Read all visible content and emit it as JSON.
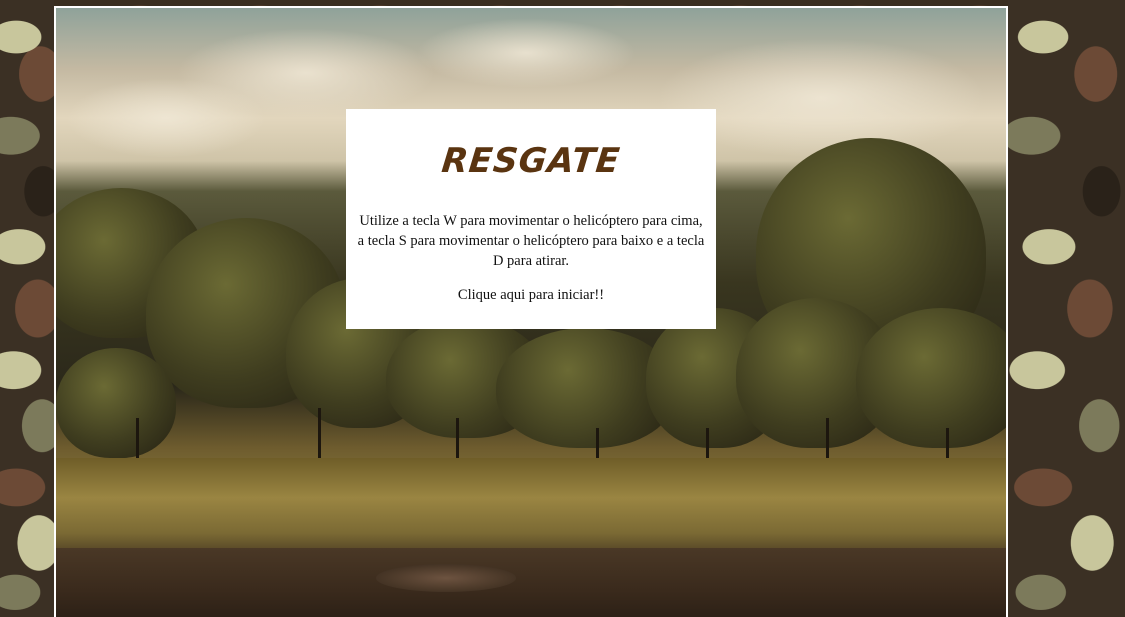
{
  "game": {
    "title": "RESGATE",
    "instructions": "Utilize a tecla W para movimentar o helicóptero para cima, a tecla S para movimentar o helicóptero para baixo e a tecla D para atirar.",
    "start_label": "Clique aqui para iniciar!!"
  },
  "colors": {
    "title": "#5a3410",
    "panel_background": "#ffffff",
    "frame_border": "#ffffff"
  }
}
